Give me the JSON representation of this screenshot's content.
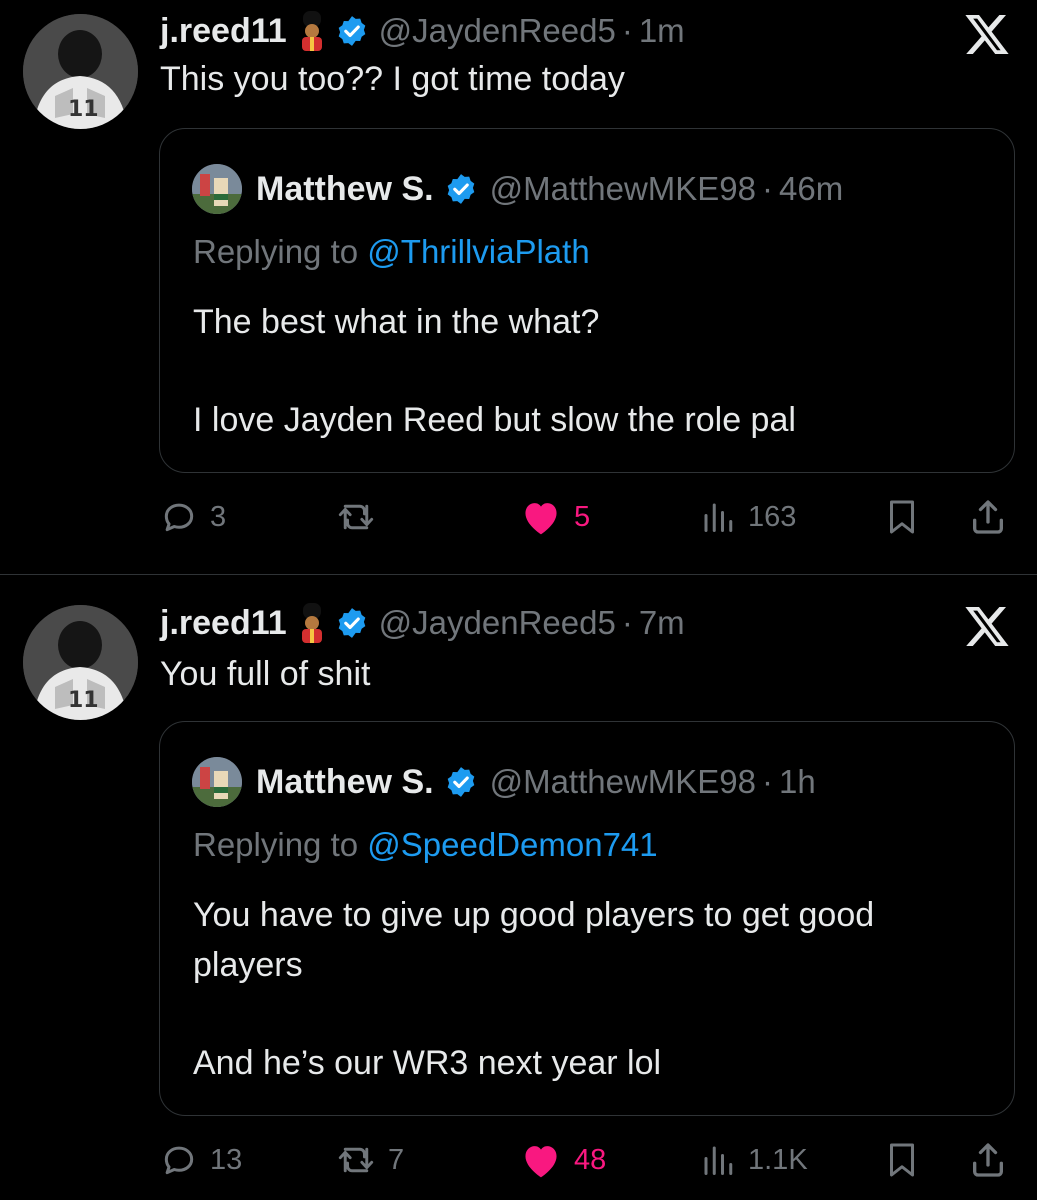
{
  "colors": {
    "background": "#000000",
    "text": "#e7e9ea",
    "secondary": "#71767b",
    "link": "#1d9bf0",
    "like": "#f91880",
    "verified": "#1d9bf0",
    "border": "#2f3336"
  },
  "icons": {
    "verified": "verified-badge-icon",
    "close": "x-logo-icon",
    "reply": "reply-bubble-icon",
    "retweet": "retweet-icon",
    "like": "heart-icon",
    "views": "bar-chart-icon",
    "bookmark": "bookmark-icon",
    "share": "share-upload-icon",
    "emoji": "guard-emoji"
  },
  "tweets": [
    {
      "author": {
        "name": "j.reed11",
        "handle": "@JaydenReed5",
        "time": "1m"
      },
      "text": "This you too?? I got time today",
      "quote": {
        "name": "Matthew S.",
        "handle": "@MatthewMKE98",
        "time": "46m",
        "replying_label": "Replying to",
        "replying_to": "@ThrillviaPlath",
        "paragraphs": [
          "The best what in the what?",
          "I love Jayden Reed but slow the role pal"
        ]
      },
      "stats": {
        "replies": "3",
        "retweets": "",
        "likes": "5",
        "views": "163"
      }
    },
    {
      "author": {
        "name": "j.reed11",
        "handle": "@JaydenReed5",
        "time": "7m"
      },
      "text": "You full of shit",
      "quote": {
        "name": "Matthew S.",
        "handle": "@MatthewMKE98",
        "time": "1h",
        "replying_label": "Replying to",
        "replying_to": "@SpeedDemon741",
        "paragraphs": [
          "You have to give up good players to get good players",
          "And he’s our WR3 next year lol"
        ]
      },
      "stats": {
        "replies": "13",
        "retweets": "7",
        "likes": "48",
        "views": "1.1K"
      }
    }
  ],
  "separator": "·"
}
